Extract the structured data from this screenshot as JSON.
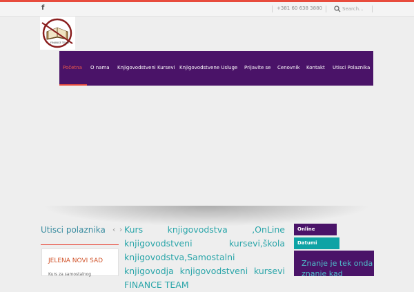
{
  "topbar": {
    "facebook_glyph": "f",
    "phone": "+381 60 638 3880",
    "search_placeholder": "Search..."
  },
  "logo": {
    "text": "FINANCE TEAM"
  },
  "nav": {
    "items": [
      {
        "label": "Početna",
        "active": true
      },
      {
        "label": "O nama"
      },
      {
        "label": "Knjigovodstveni Kursevi"
      },
      {
        "label": "Knjigovodstvene Usluge"
      },
      {
        "label": "Prijavite se"
      },
      {
        "label": "Cenovnik"
      },
      {
        "label": "Kontakt"
      },
      {
        "label": "Utisci Polaznika"
      }
    ]
  },
  "sidebar": {
    "title": "Utisci polaznika",
    "testimonial": {
      "name": "JELENA NOVI SAD",
      "text": "Kurs za samostalnog"
    }
  },
  "content": {
    "arrows": "‹ ›",
    "headline": "Kurs knjigovodstva ,OnLine knjigovodstveni kursevi,škola knjigovodstva,Samostalni knjigovodja knjigovodstveni kursevi FINANCE TEAM"
  },
  "right": {
    "online_label": "Online prijave",
    "datumi_label": "Datumi kurseva",
    "promo_text": "Znanje je tek onda znanje kad"
  },
  "colors": {
    "purple": "#4a1368",
    "teal": "#0ea3a5",
    "red": "#e84c3d",
    "headline": "#2aa5a9"
  }
}
